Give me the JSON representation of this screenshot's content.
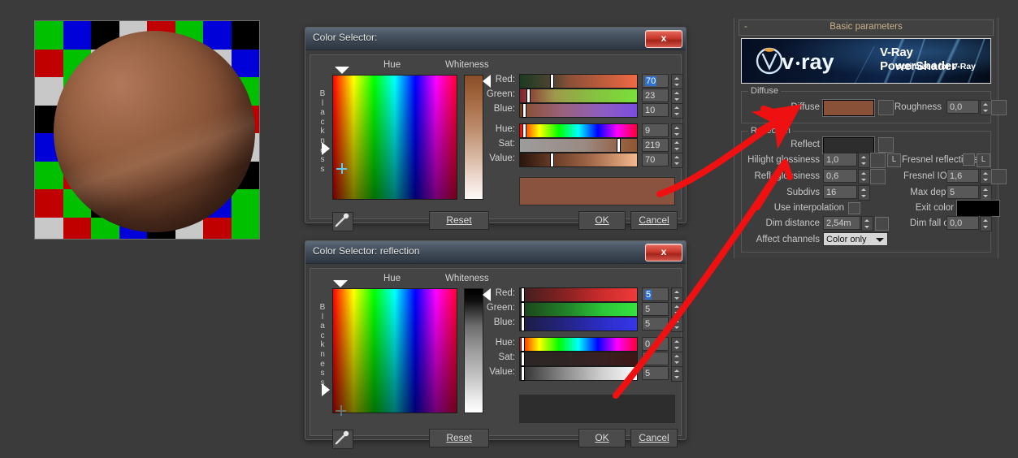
{
  "app": {
    "background_color": "#3b3b3b"
  },
  "render_view": {
    "name": "rendered-sphere-preview",
    "sphere_color": "#8a5539",
    "checker_colors": [
      "#00c000",
      "#0000d8",
      "#000000",
      "#c8c8c8",
      "#c00000"
    ]
  },
  "color_selector_diffuse": {
    "title": "Color Selector:",
    "close_label": "x",
    "hue_label": "Hue",
    "whiteness_label": "Whiteness",
    "blackness_label": "Blackness",
    "channels": [
      {
        "name": "Red:",
        "value": "70",
        "selected": true
      },
      {
        "name": "Green:",
        "value": "23",
        "selected": false
      },
      {
        "name": "Blue:",
        "value": "10",
        "selected": false
      },
      {
        "name": "Hue:",
        "value": "9",
        "selected": false
      },
      {
        "name": "Sat:",
        "value": "219",
        "selected": false
      },
      {
        "name": "Value:",
        "value": "70",
        "selected": false
      }
    ],
    "preview_color": "#8a5340",
    "reset_label": "Reset",
    "ok_label": "OK",
    "cancel_label": "Cancel",
    "eyedropper_icon": "eyedropper-icon"
  },
  "color_selector_reflection": {
    "title": "Color Selector: reflection",
    "close_label": "x",
    "hue_label": "Hue",
    "whiteness_label": "Whiteness",
    "blackness_label": "Blackness",
    "channels": [
      {
        "name": "Red:",
        "value": "5",
        "selected": true
      },
      {
        "name": "Green:",
        "value": "5",
        "selected": false
      },
      {
        "name": "Blue:",
        "value": "5",
        "selected": false
      },
      {
        "name": "Hue:",
        "value": "0",
        "selected": false
      },
      {
        "name": "Sat:",
        "value": "",
        "selected": false
      },
      {
        "name": "Value:",
        "value": "5",
        "selected": false
      }
    ],
    "preview_color": "#2d2d2d",
    "reset_label": "Reset",
    "ok_label": "OK",
    "cancel_label": "Cancel",
    "eyedropper_icon": "eyedropper-icon"
  },
  "vray_panel": {
    "rollout_title": "Basic parameters",
    "collapse_glyph": "-",
    "banner": {
      "logo_text": "v·ray",
      "product_title": "V-Ray PowerShader",
      "product_subtitle": "optimized for V-Ray"
    },
    "diffuse_group": {
      "title": "Diffuse",
      "diffuse_label": "Diffuse",
      "diffuse_color": "#8a5139",
      "roughness_label": "Roughness",
      "roughness_value": "0,0"
    },
    "reflection_group": {
      "title": "Reflection",
      "reflect_label": "Reflect",
      "reflect_color": "#2d2d2d",
      "hilight_glossiness_label": "Hilight glossiness",
      "hilight_glossiness_value": "1,0",
      "refl_glossiness_label": "Refl. glossiness",
      "refl_glossiness_value": "0,6",
      "subdivs_label": "Subdivs",
      "subdivs_value": "16",
      "use_interpolation_label": "Use interpolation",
      "dim_distance_label": "Dim distance",
      "dim_distance_value": "2,54m",
      "affect_channels_label": "Affect channels",
      "affect_channels_value": "Color only",
      "fresnel_reflections_label": "Fresnel reflections",
      "fresnel_ior_label": "Fresnel IOR",
      "fresnel_ior_value": "1,6",
      "max_depth_label": "Max depth",
      "max_depth_value": "5",
      "exit_color_label": "Exit color",
      "exit_color": "#000000",
      "dim_falloff_label": "Dim fall off",
      "dim_falloff_value": "0,0",
      "lock_button_label": "L"
    }
  },
  "annotations": {
    "arrow_color": "#ef1111",
    "arrow_1_target": "diffuse-swatch",
    "arrow_2_target": "reflect-swatch"
  }
}
